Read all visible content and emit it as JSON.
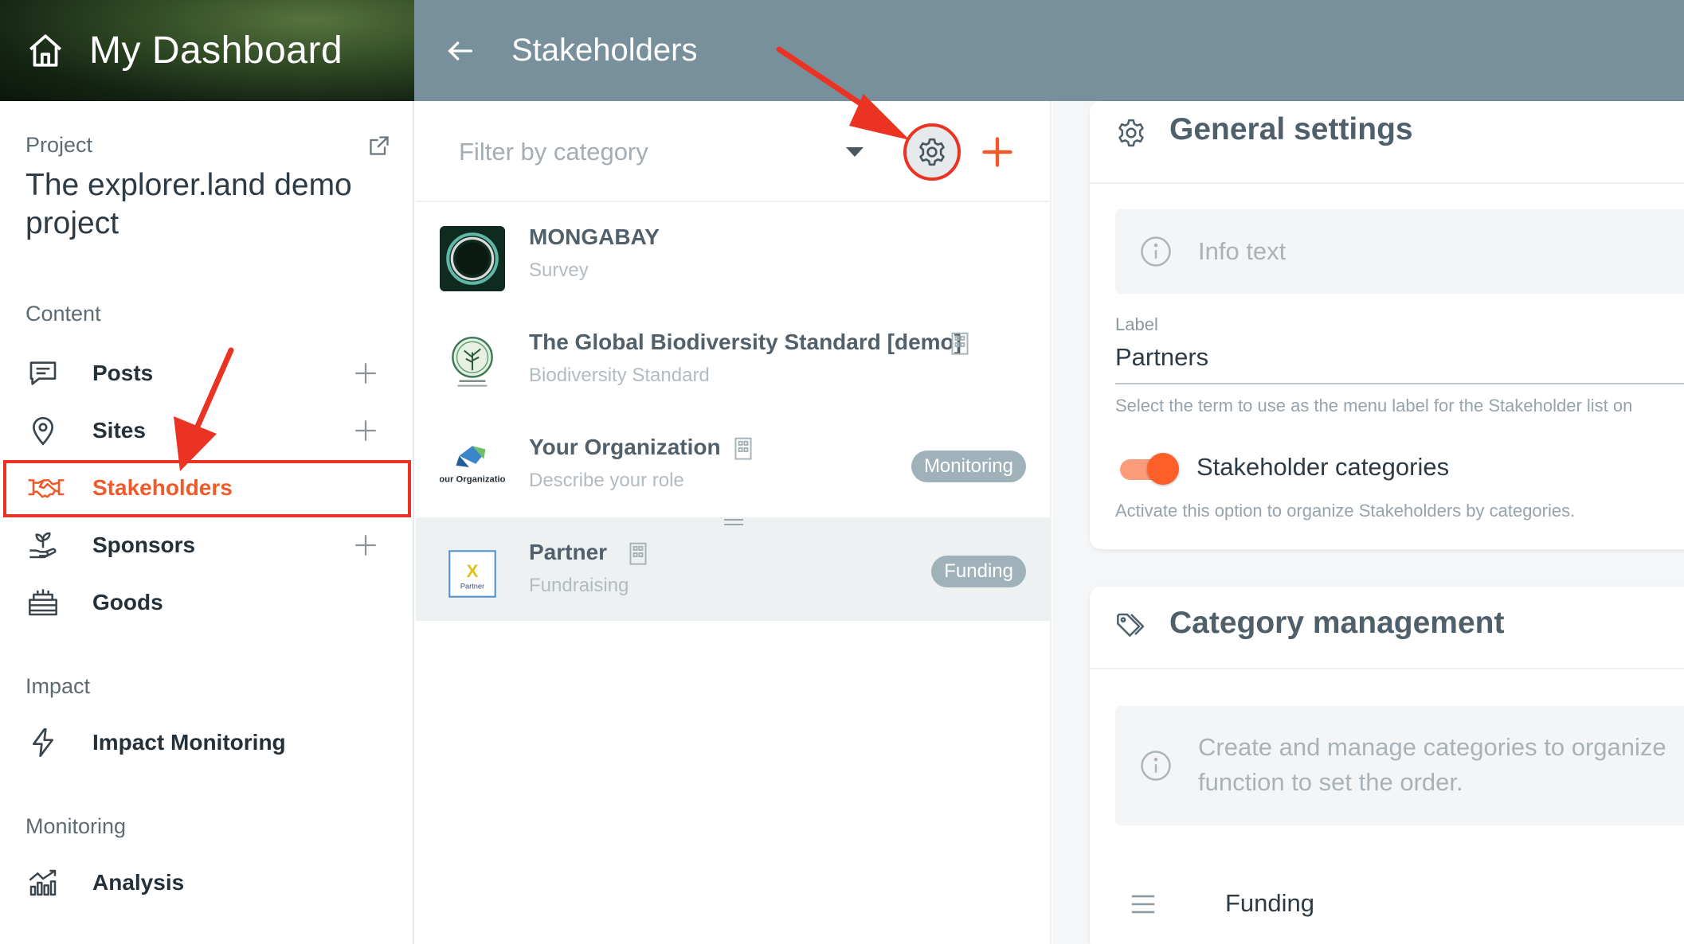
{
  "header": {
    "brand_title": "My Dashboard",
    "page_title": "Stakeholders"
  },
  "sidebar": {
    "project_label": "Project",
    "project_name": "The explorer.land demo project",
    "sections": {
      "content": "Content",
      "impact": "Impact",
      "monitoring": "Monitoring"
    },
    "items": [
      {
        "label": "Posts",
        "icon": "chat-icon"
      },
      {
        "label": "Sites",
        "icon": "map-pin-icon"
      },
      {
        "label": "Stakeholders",
        "icon": "handshake-icon",
        "active": true
      },
      {
        "label": "Sponsors",
        "icon": "plant-hand-icon"
      },
      {
        "label": "Goods",
        "icon": "goods-icon"
      },
      {
        "label": "Impact Monitoring",
        "icon": "lightning-icon"
      },
      {
        "label": "Analysis",
        "icon": "analysis-chart-icon"
      }
    ]
  },
  "list": {
    "filter_placeholder": "Filter by category",
    "items": [
      {
        "name": "MONGABAY",
        "sub": "Survey",
        "badge": ""
      },
      {
        "name": "The Global Biodiversity Standard [demo]",
        "sub": "Biodiversity Standard",
        "badge": ""
      },
      {
        "name": "Your Organization",
        "sub": "Describe your role",
        "badge": "Monitoring"
      },
      {
        "name": "Partner",
        "sub": "Fundraising",
        "badge": "Funding"
      }
    ],
    "logo_texts": {
      "your_org": "Your Organization",
      "partner_x": "X",
      "partner": "Partner"
    }
  },
  "settings": {
    "general_title": "General settings",
    "info_text": "Info text",
    "label_caption": "Label",
    "label_value": "Partners",
    "label_hint": "Select the term to use as the menu label for the Stakeholder list on",
    "toggle_label": "Stakeholder categories",
    "toggle_on": true,
    "toggle_hint": "Activate this option to organize Stakeholders by categories.",
    "category_title": "Category management",
    "category_info_line1": "Create and manage categories to organize",
    "category_info_line2": "function to set the order.",
    "categories": [
      "Funding"
    ]
  },
  "colors": {
    "accent": "#f05a28",
    "annotation_red": "#ea3323",
    "topbar": "#78909c",
    "badge": "#9fb2ba"
  }
}
